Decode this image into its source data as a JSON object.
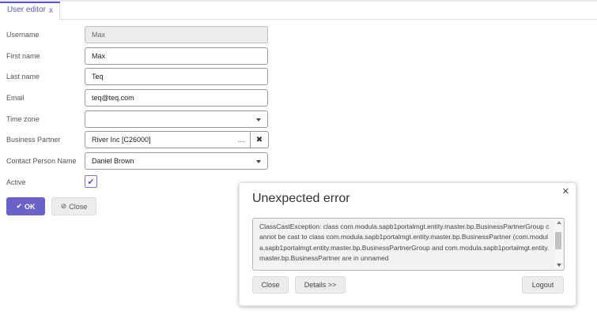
{
  "tab": {
    "label": "User editor",
    "close": "x"
  },
  "form": {
    "username": {
      "label": "Username",
      "value": "Max"
    },
    "first_name": {
      "label": "First name",
      "value": "Max"
    },
    "last_name": {
      "label": "Last name",
      "value": "Teq"
    },
    "email": {
      "label": "Email",
      "value": "teq@teq.com"
    },
    "time_zone": {
      "label": "Time zone",
      "value": ""
    },
    "business_partner": {
      "label": "Business Partner",
      "value": "River Inc [C26000]",
      "lookup": "…",
      "clear": "✖"
    },
    "contact_person": {
      "label": "Contact Person Name",
      "value": "Daniel Brown"
    },
    "active": {
      "label": "Active",
      "checked": true,
      "check_glyph": "✔"
    }
  },
  "buttons": {
    "ok_icon": "✔",
    "ok": "OK",
    "close_icon": "⊘",
    "close": "Close"
  },
  "dialog": {
    "title": "Unexpected error",
    "close_x": "✕",
    "message": "ClassCastException: class com.modula.sapb1portalmgt.entity.master.bp.BusinessPartnerGroup cannot be cast to class com.modula.sapb1portalmgt.entity.master.bp.BusinessPartner (com.modula.sapb1portalmgt.entity.master.bp.BusinessPartnerGroup and com.modula.sapb1portalmgt.entity.master.bp.BusinessPartner are in unnamed",
    "buttons": {
      "close": "Close",
      "details": "Details >>",
      "logout": "Logout"
    }
  },
  "colors": {
    "accent": "#6a62c6",
    "tab_text": "#5c55c4"
  }
}
